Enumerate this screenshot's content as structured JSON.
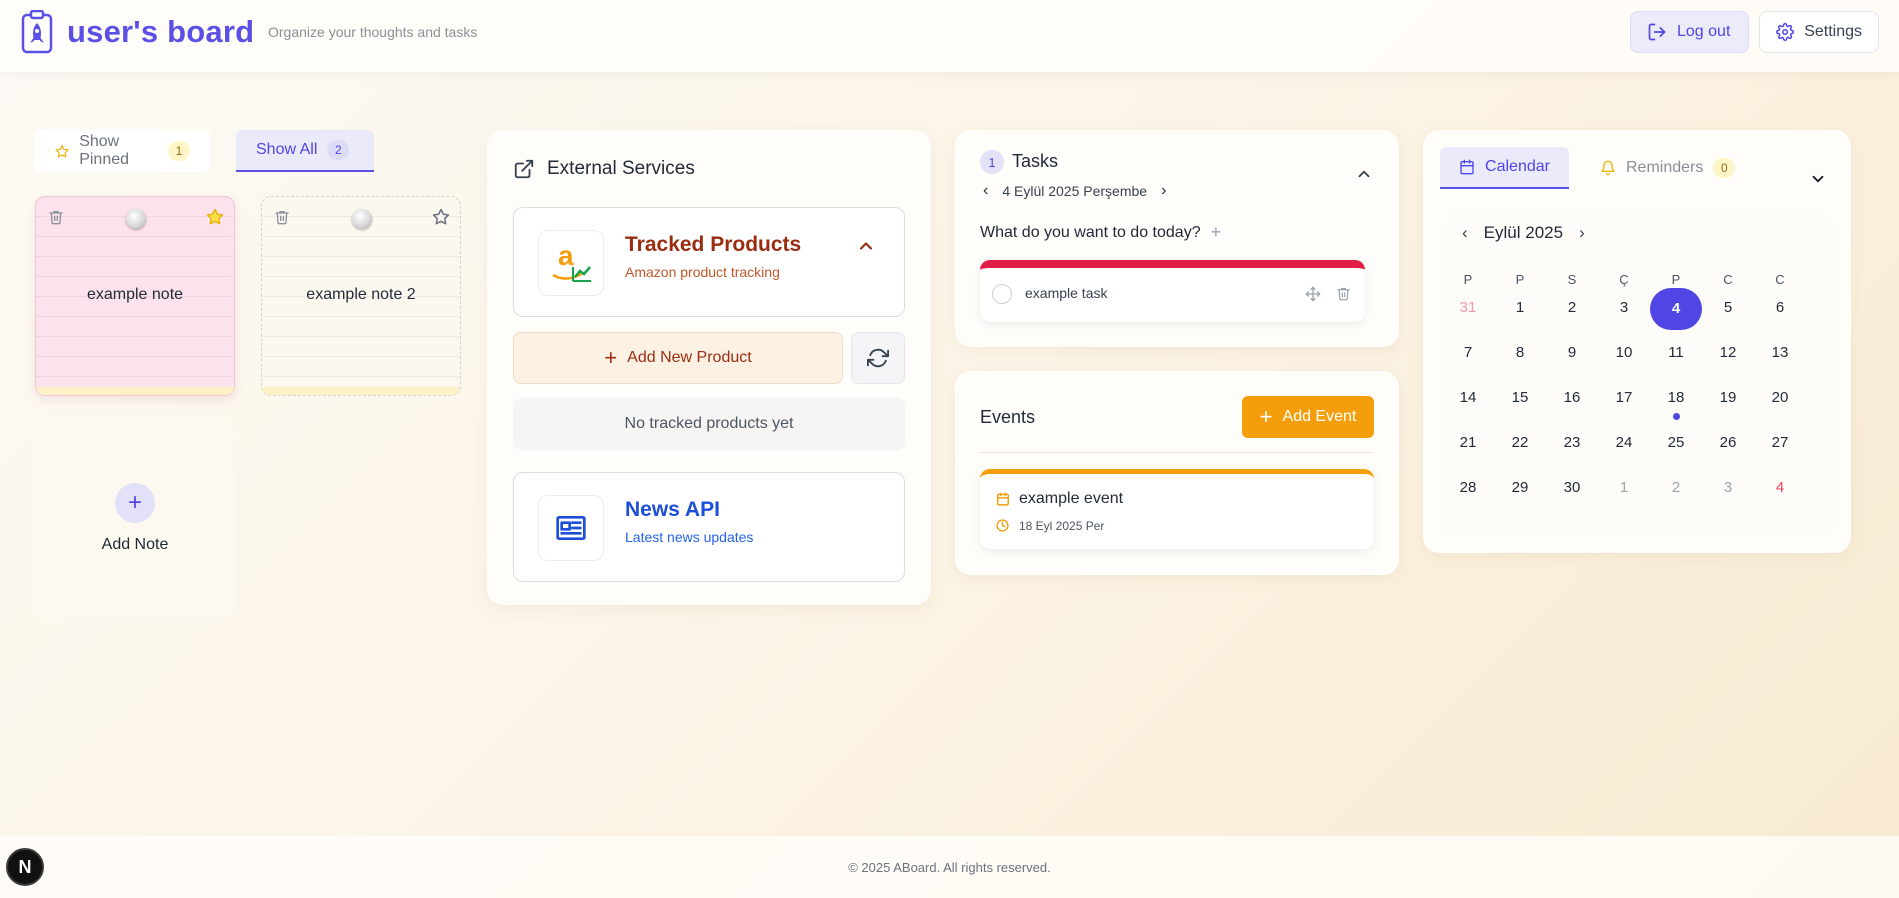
{
  "header": {
    "title": "user's board",
    "subtitle": "Organize your thoughts and tasks",
    "logout_label": "Log out",
    "settings_label": "Settings",
    "brand_color": "#5b50e6"
  },
  "notes": {
    "tabs": [
      {
        "label": "Show Pinned",
        "count": "1"
      },
      {
        "label": "Show All",
        "count": "2"
      }
    ],
    "items": [
      {
        "text": "example note",
        "pinned": true,
        "color": "#fbe2ec"
      },
      {
        "text": "example note 2",
        "pinned": false,
        "color": "#fcf8f0"
      }
    ],
    "add_label": "Add Note"
  },
  "external": {
    "title": "External Services",
    "amazon": {
      "title": "Tracked Products",
      "subtitle": "Amazon product tracking"
    },
    "add_product_label": "Add New Product",
    "empty_text": "No tracked products yet",
    "news": {
      "title": "News API",
      "subtitle": "Latest news updates"
    }
  },
  "tasks": {
    "count": "1",
    "title": "Tasks",
    "date": "4 Eylül 2025 Perşembe",
    "prompt": "What do you want to do today?",
    "items": [
      {
        "text": "example task",
        "priority_color": "#e11d48"
      }
    ]
  },
  "events": {
    "title": "Events",
    "add_label": "Add Event",
    "items": [
      {
        "title": "example event",
        "date": "18 Eyl 2025 Per"
      }
    ]
  },
  "calendar": {
    "tab_calendar": "Calendar",
    "tab_reminders": "Reminders",
    "reminders_count": "0",
    "month": "Eylül 2025",
    "weekdays": [
      "P",
      "P",
      "S",
      "Ç",
      "P",
      "C",
      "C"
    ],
    "weeks": [
      [
        "31",
        "1",
        "2",
        "3",
        "4",
        "5",
        "6"
      ],
      [
        "7",
        "8",
        "9",
        "10",
        "11",
        "12",
        "13"
      ],
      [
        "14",
        "15",
        "16",
        "17",
        "18",
        "19",
        "20"
      ],
      [
        "21",
        "22",
        "23",
        "24",
        "25",
        "26",
        "27"
      ],
      [
        "28",
        "29",
        "30",
        "1",
        "2",
        "3",
        "4"
      ]
    ],
    "selected_day": "4",
    "event_day": "18"
  },
  "footer": {
    "copyright": "© 2025 ABoard. All rights reserved.",
    "badge": "N"
  }
}
